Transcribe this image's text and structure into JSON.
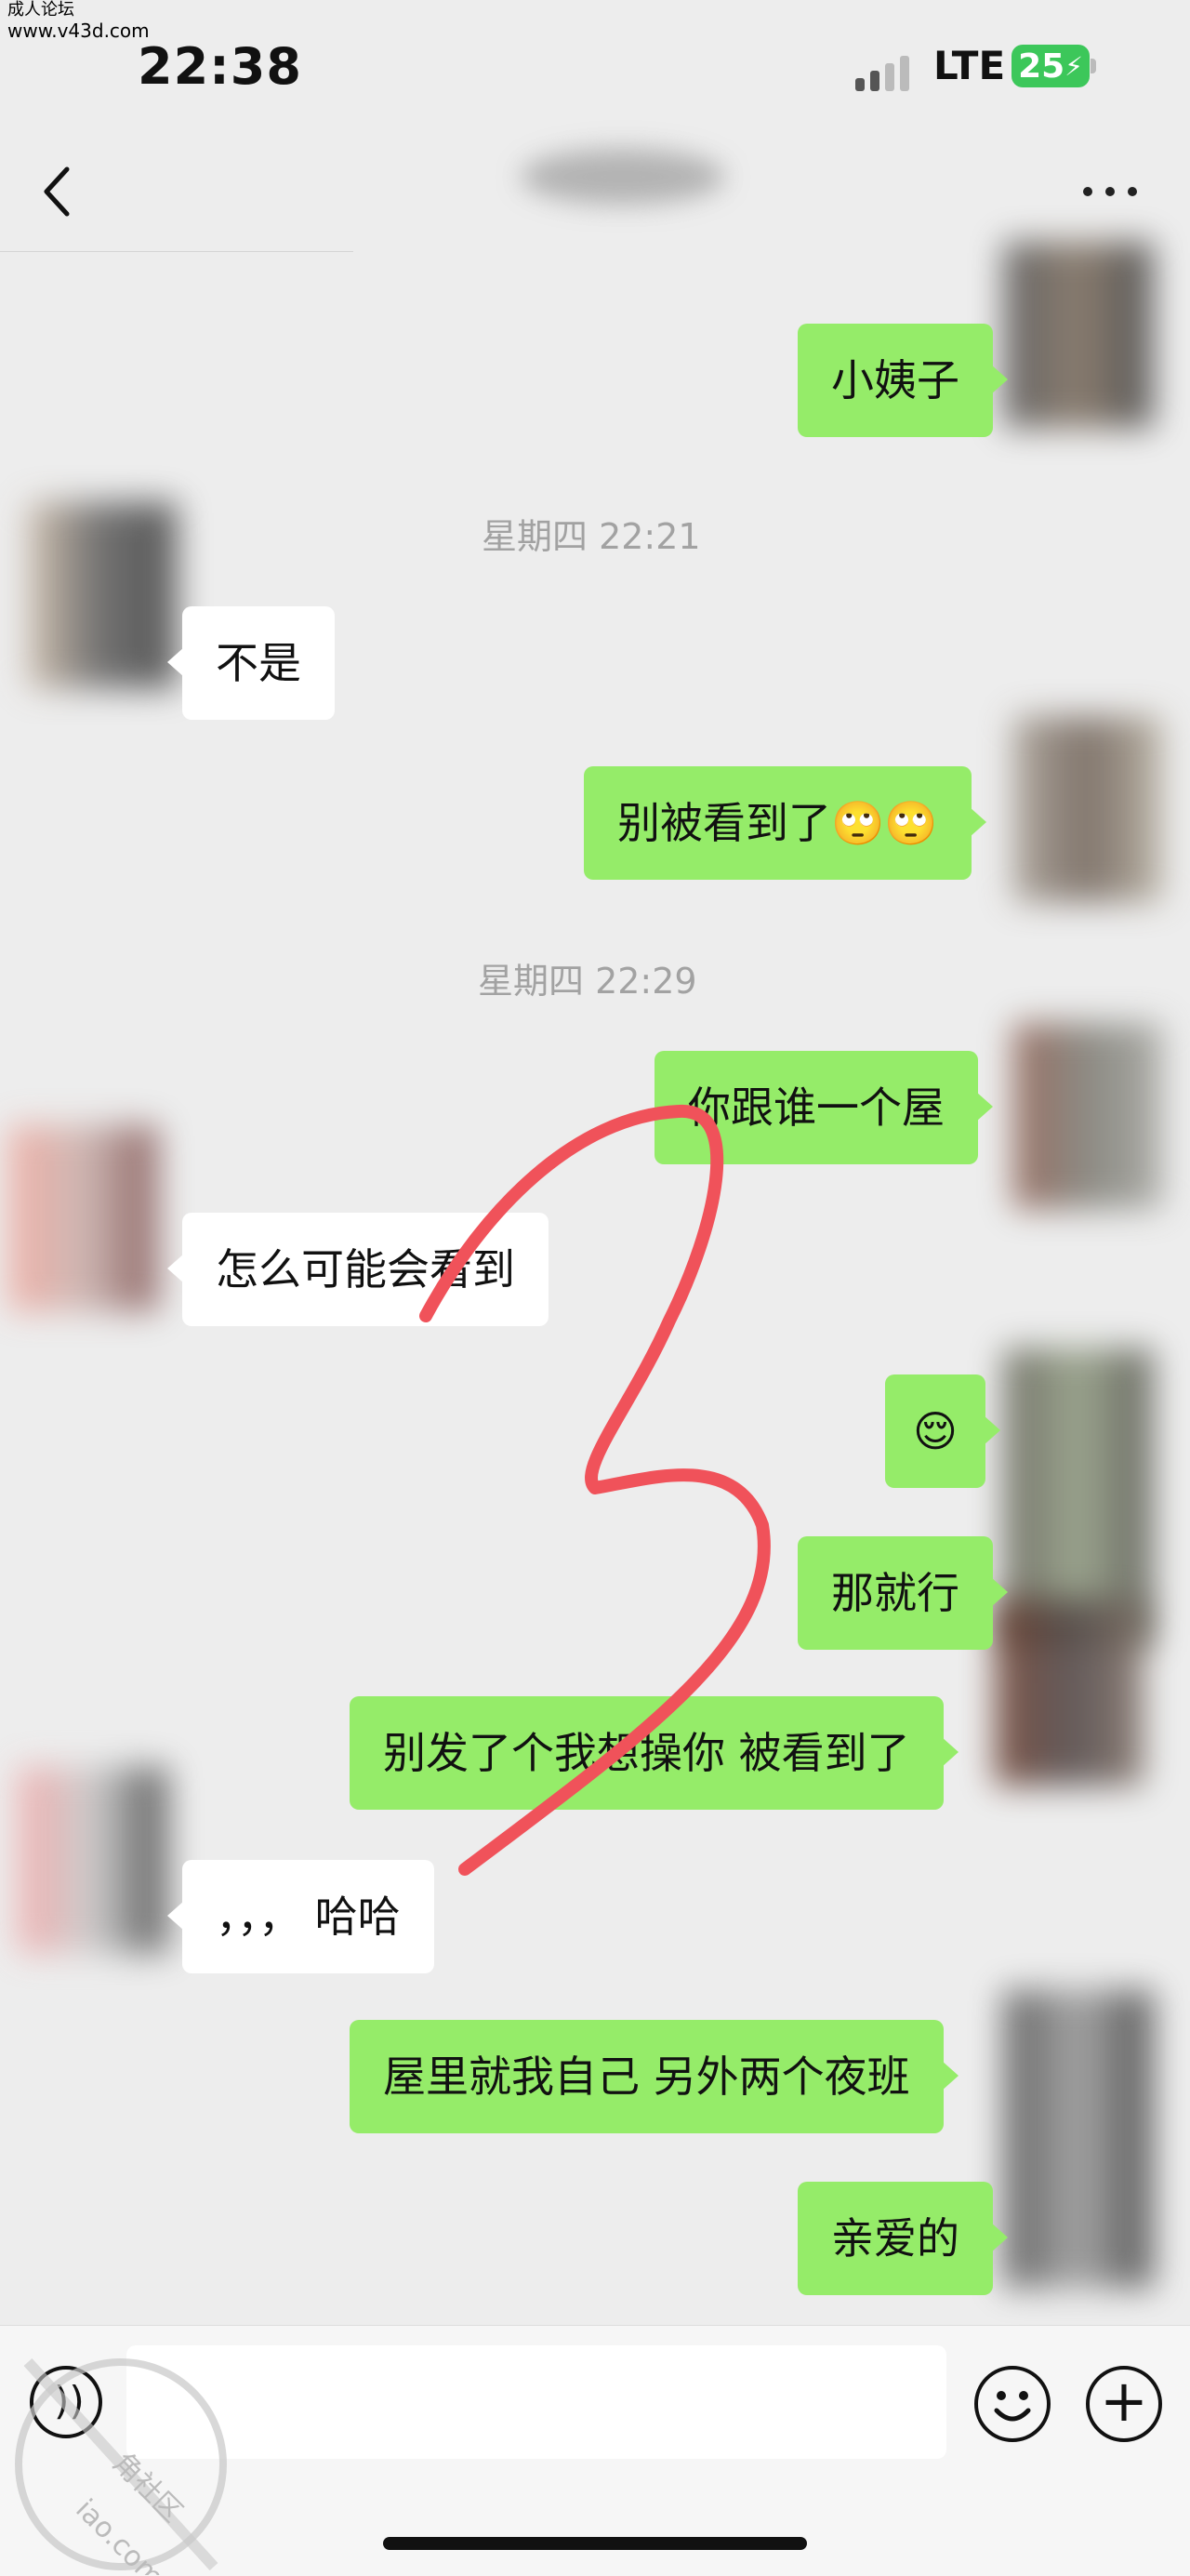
{
  "watermark": {
    "line1": "成人论坛",
    "line2": "www.v43d.com"
  },
  "status_bar": {
    "time": "22:38",
    "network": "LTE",
    "battery": "25"
  },
  "messages": [
    {
      "side": "mine",
      "text": "小姨子"
    },
    {
      "type": "timestamp",
      "text": "星期四 22:21"
    },
    {
      "side": "theirs",
      "text": "不是"
    },
    {
      "side": "mine",
      "text": "别被看到了🙄🙄"
    },
    {
      "type": "timestamp",
      "text": "星期四 22:29"
    },
    {
      "side": "mine",
      "text": "你跟谁一个屋"
    },
    {
      "side": "theirs",
      "text": "怎么可能会看到"
    },
    {
      "side": "mine",
      "text": "😌"
    },
    {
      "side": "mine",
      "text": "那就行"
    },
    {
      "side": "mine",
      "text": "别发了个我想操你 被看到了"
    },
    {
      "side": "theirs",
      "text": "，，， 哈哈"
    },
    {
      "side": "mine",
      "text": "屋里就我自己 另外两个夜班"
    },
    {
      "side": "mine",
      "text": "亲爱的"
    }
  ],
  "icons": {
    "back": "chevron-left-icon",
    "more": "more-dots-icon",
    "voice": "voice-icon",
    "emoji": "emoji-icon",
    "plus": "plus-icon"
  },
  "stamp": {
    "text1": "角社区",
    "text2": "iao.com"
  },
  "colors": {
    "my_bubble": "#95ec69",
    "their_bubble": "#ffffff",
    "background": "#ededed",
    "annotation": "#f0525a"
  }
}
